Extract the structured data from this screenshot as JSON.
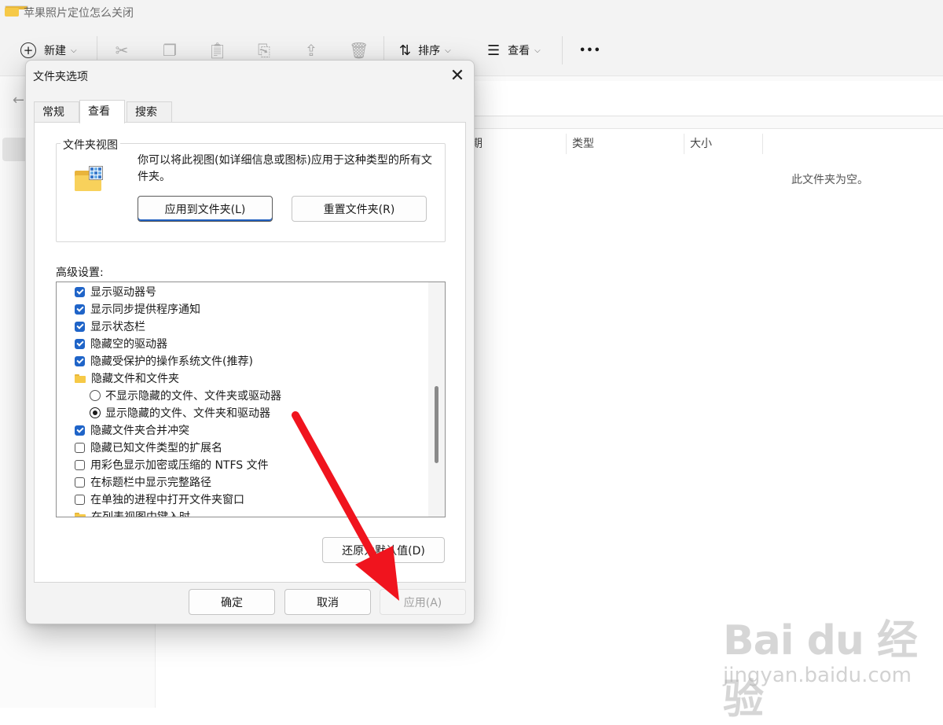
{
  "window": {
    "title": "苹果照片定位怎么关闭"
  },
  "toolbar": {
    "new_label": "新建",
    "sort_label": "排序",
    "view_label": "查看",
    "more_label": "•••"
  },
  "columns": {
    "date_fragment": "期",
    "type": "类型",
    "size": "大小"
  },
  "content": {
    "empty_message": "此文件夹为空。"
  },
  "dialog": {
    "title": "文件夹选项",
    "close_glyph": "✕",
    "tabs": [
      {
        "label": "常规",
        "active": false
      },
      {
        "label": "查看",
        "active": true
      },
      {
        "label": "搜索",
        "active": false
      }
    ],
    "folder_views": {
      "legend": "文件夹视图",
      "description": "你可以将此视图(如详细信息或图标)应用于这种类型的所有文件夹。",
      "apply_button": "应用到文件夹(L)",
      "reset_button": "重置文件夹(R)"
    },
    "advanced_label": "高级设置:",
    "advanced_items": [
      {
        "kind": "checkbox",
        "checked": true,
        "label": "显示驱动器号"
      },
      {
        "kind": "checkbox",
        "checked": true,
        "label": "显示同步提供程序通知"
      },
      {
        "kind": "checkbox",
        "checked": true,
        "label": "显示状态栏"
      },
      {
        "kind": "checkbox",
        "checked": true,
        "label": "隐藏空的驱动器"
      },
      {
        "kind": "checkbox",
        "checked": true,
        "label": "隐藏受保护的操作系统文件(推荐)"
      },
      {
        "kind": "folder",
        "label": "隐藏文件和文件夹"
      },
      {
        "kind": "radio",
        "checked": false,
        "label": "不显示隐藏的文件、文件夹或驱动器"
      },
      {
        "kind": "radio",
        "checked": true,
        "label": "显示隐藏的文件、文件夹和驱动器"
      },
      {
        "kind": "checkbox",
        "checked": true,
        "label": "隐藏文件夹合并冲突"
      },
      {
        "kind": "checkbox",
        "checked": false,
        "label": "隐藏已知文件类型的扩展名"
      },
      {
        "kind": "checkbox",
        "checked": false,
        "label": "用彩色显示加密或压缩的 NTFS 文件"
      },
      {
        "kind": "checkbox",
        "checked": false,
        "label": "在标题栏中显示完整路径"
      },
      {
        "kind": "checkbox",
        "checked": false,
        "label": "在单独的进程中打开文件夹窗口"
      },
      {
        "kind": "folder",
        "label": "在列表视图中键入时"
      }
    ],
    "restore_button": "还原为默认值(D)",
    "ok_button": "确定",
    "cancel_button": "取消",
    "apply_button": "应用(A)"
  },
  "annotation": {
    "arrow_color": "#f0141e"
  },
  "watermark": {
    "brand": "Bai du 经验",
    "site": "jingyan.baidu.com"
  }
}
